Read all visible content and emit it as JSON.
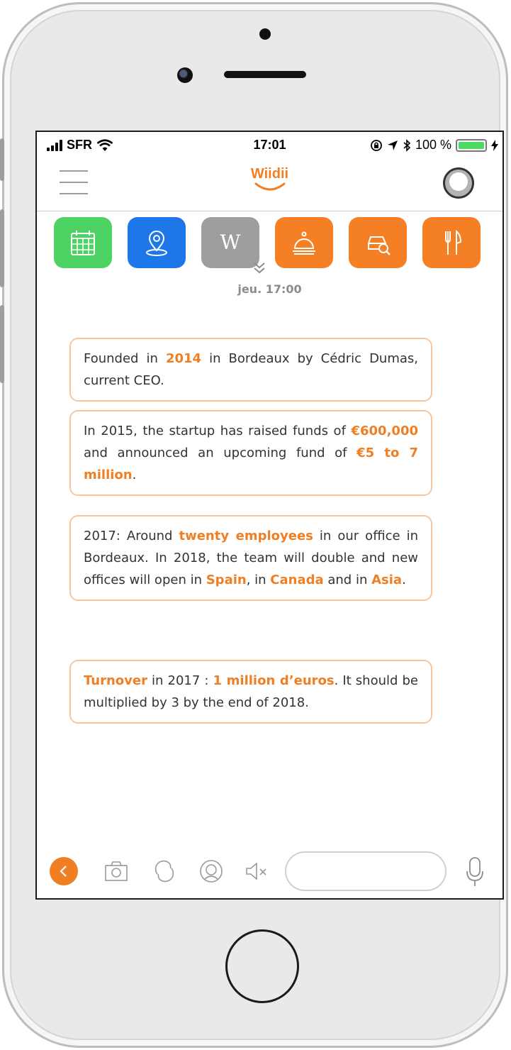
{
  "status_bar": {
    "carrier": "SFR",
    "time": "17:01",
    "battery": "100 %"
  },
  "header": {
    "logo": "Wiidii",
    "icons": [
      "menu-icon",
      "avatar"
    ]
  },
  "shortcuts": [
    {
      "name": "calendar",
      "color": "#4cd364"
    },
    {
      "name": "location",
      "color": "#1e77e8"
    },
    {
      "name": "wikipedia",
      "color": "#9e9e9e"
    },
    {
      "name": "concierge",
      "color": "#f57f25"
    },
    {
      "name": "car-search",
      "color": "#f57f25"
    },
    {
      "name": "restaurant",
      "color": "#f57f25"
    }
  ],
  "chat": {
    "timestamp": "jeu. 17:00",
    "messages": [
      {
        "parts": [
          {
            "text": "Founded in "
          },
          {
            "text": "2014",
            "highlight": true
          },
          {
            "text": " in Bordeaux by Cédric Dumas, current CEO."
          }
        ]
      },
      {
        "parts": [
          {
            "text": "In 2015, the startup has raised funds of "
          },
          {
            "text": "€600,000",
            "highlight": true
          },
          {
            "text": " and announced an upcoming fund of "
          },
          {
            "text": "€5 to 7 million",
            "highlight": true
          },
          {
            "text": "."
          }
        ]
      },
      {
        "parts": [
          {
            "text": "2017: Around "
          },
          {
            "text": "twenty employees",
            "highlight": true
          },
          {
            "text": " in our office in Bordeaux. In 2018, the team will double and new offices will open in "
          },
          {
            "text": "Spain",
            "highlight": true
          },
          {
            "text": ", in "
          },
          {
            "text": "Canada",
            "highlight": true
          },
          {
            "text": " and in "
          },
          {
            "text": "Asia",
            "highlight": true
          },
          {
            "text": "."
          }
        ]
      },
      {
        "parts": [
          {
            "text": "Turnover",
            "highlight": true
          },
          {
            "text": " in 2017 : "
          },
          {
            "text": "1 million d’euros",
            "highlight": true
          },
          {
            "text": ".  It should be multiplied by 3 by the end of 2018."
          }
        ]
      }
    ]
  },
  "bottom_bar": {
    "tools": [
      "back-icon",
      "camera-icon",
      "refresh-icon",
      "assistant-icon",
      "mute-icon",
      "microphone-icon"
    ],
    "input_value": ""
  },
  "colors": {
    "accent": "#f07f24",
    "bubble_border": "#f7c7a2"
  }
}
